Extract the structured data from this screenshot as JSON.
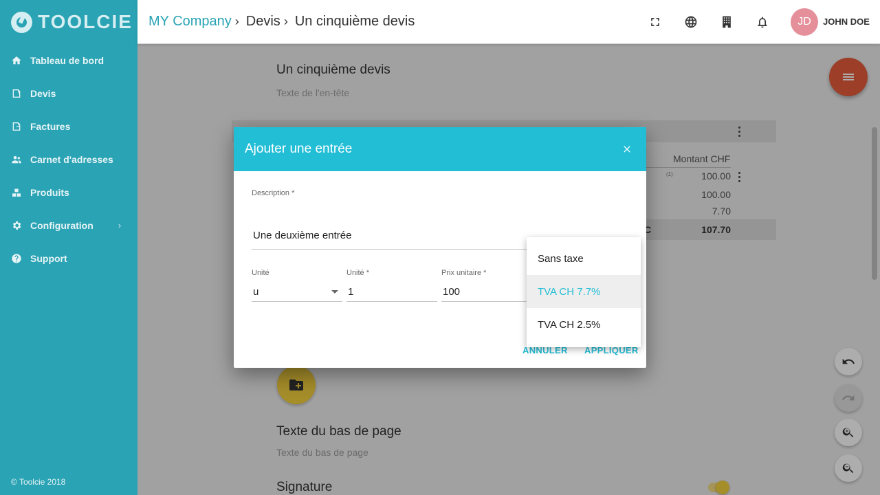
{
  "app": {
    "logo_text": "TOOLCIE",
    "copyright": "© Toolcie 2018"
  },
  "sidebar": {
    "items": [
      {
        "label": "Tableau de bord",
        "icon": "home-icon"
      },
      {
        "label": "Devis",
        "icon": "quote-icon"
      },
      {
        "label": "Factures",
        "icon": "invoice-icon"
      },
      {
        "label": "Carnet d'adresses",
        "icon": "contacts-icon"
      },
      {
        "label": "Produits",
        "icon": "products-icon"
      },
      {
        "label": "Configuration",
        "icon": "gear-icon"
      },
      {
        "label": "Support",
        "icon": "help-icon"
      }
    ]
  },
  "header": {
    "breadcrumb": [
      "MY Company",
      "Devis",
      "Un cinquième devis"
    ],
    "avatar_initials": "JD",
    "user_name": "JOHN DOE",
    "icons": [
      "fullscreen-icon",
      "globe-icon",
      "building-icon",
      "bell-icon"
    ]
  },
  "document": {
    "title": "Un cinquième devis",
    "header_placeholder": "Texte de l'en-tête",
    "amount_column": "Montant CHF",
    "row_note": "(1)",
    "values": [
      "100.00",
      "100.00",
      "7.70"
    ],
    "total_prefix": "C",
    "total": "107.70",
    "footer_title": "Texte du bas de page",
    "footer_placeholder": "Texte du bas de page",
    "signature_title": "Signature",
    "signature_enabled": true
  },
  "dialog": {
    "title": "Ajouter une entrée",
    "description_label": "Description *",
    "description_value": "Une deuxième entrée",
    "unit_type_label": "Unité",
    "unit_type_value": "u",
    "quantity_label": "Unité *",
    "quantity_value": "1",
    "price_label": "Prix unitaire *",
    "price_value": "100",
    "cancel_label": "ANNULER",
    "apply_label": "APPLIQUER"
  },
  "tax_dropdown": {
    "options": [
      "Sans taxe",
      "TVA CH 7.7%",
      "TVA CH 2.5%"
    ],
    "selected": "TVA CH 7.7%"
  },
  "colors": {
    "sidebar": "#2aa3b4",
    "dialog_header": "#22bed6",
    "menu_fab": "#e65c3c",
    "add_fab": "#f4d03f",
    "avatar": "#e48f9a"
  }
}
